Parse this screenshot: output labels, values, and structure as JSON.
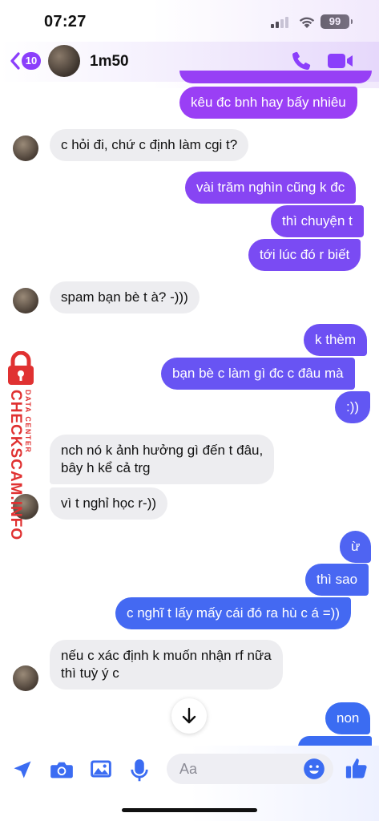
{
  "status_bar": {
    "time": "07:27",
    "battery": "99"
  },
  "header": {
    "back_count": "10",
    "name": "1m50"
  },
  "messages": {
    "m1": "kêu đc bnh hay bấy nhiêu",
    "m2": "c hỏi đi, chứ c định làm cgi t?",
    "m3": "vài trăm nghìn cũng k đc",
    "m4": "thì chuyện t",
    "m5": "tới lúc đó r biết",
    "m6": "spam bạn bè t à? -)))",
    "m7": "k thèm",
    "m8": "bạn bè c làm gì đc c đâu mà",
    "m9": ":))",
    "m10a": "nch nó k ảnh hưởng gì đến t đâu,",
    "m10b": "bây h kể cả trg",
    "m11": "vì t nghỉ học r-))",
    "m12": "ừ",
    "m13": "thì sao",
    "m14": "c nghĩ t lấy mấy cái đó ra hù c á =))",
    "m15a": "nếu c xác định k muốn nhận rf nữa",
    "m15b": "thì tuỳ ý c",
    "m16": "non"
  },
  "watermark": {
    "main": "CHECKSCAM.INFO",
    "sub": "DATA CENTER"
  },
  "composer": {
    "placeholder": "Aa"
  },
  "icons": {
    "back": "chevron-left-icon",
    "call": "phone-icon",
    "video": "video-camera-icon",
    "location": "location-arrow-icon",
    "camera": "camera-icon",
    "gallery": "photo-icon",
    "mic": "microphone-icon",
    "emoji": "smiley-icon",
    "like": "thumbs-up-icon",
    "scroll": "arrow-down-icon",
    "lock": "lock-icon"
  },
  "colors": {
    "accent": "#8b3ffb",
    "bubble_out_top": "#9b3ff5",
    "bubble_out_bottom": "#3b6cf2",
    "bubble_in": "#ededf0",
    "watermark": "#e03131"
  }
}
